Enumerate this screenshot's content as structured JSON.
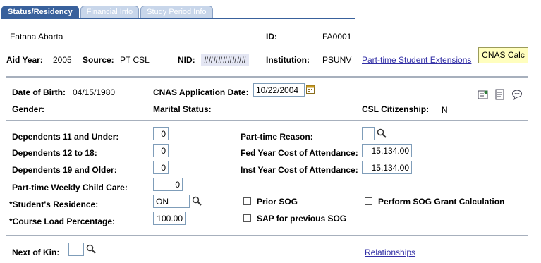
{
  "tabs": [
    "Status/Residency",
    "Financial Info",
    "Study Period Info"
  ],
  "header": {
    "name": "Fatana Abarta",
    "id_label": "ID:",
    "id_value": "FA0001",
    "aid_year_label": "Aid Year:",
    "aid_year_value": "2005",
    "source_label": "Source:",
    "source_value": "PT CSL",
    "nid_label": "NID:",
    "nid_value": "#########",
    "institution_label": "Institution:",
    "institution_value": "PSUNV",
    "extensions_link": "Part-time Student Extensions",
    "cnas_calc_button": "CNAS Calc"
  },
  "personal": {
    "dob_label": "Date of Birth:",
    "dob_value": "04/15/1980",
    "cnas_app_date_label": "CNAS Application Date:",
    "cnas_app_date_value": "10/22/2004",
    "gender_label": "Gender:",
    "marital_label": "Marital Status:",
    "citizenship_label": "CSL Citizenship:",
    "citizenship_value": "N"
  },
  "dependents": {
    "dep11_label": "Dependents 11 and Under:",
    "dep11_value": "0",
    "dep12_label": "Dependents 12 to 18:",
    "dep12_value": "0",
    "dep19_label": "Dependents 19 and Older:",
    "dep19_value": "0",
    "childcare_label": "Part-time Weekly Child Care:",
    "childcare_value": "0",
    "residence_label": "*Student's Residence:",
    "residence_value": "ON",
    "courseload_label": "*Course Load Percentage:",
    "courseload_value": "100.00"
  },
  "costs": {
    "pt_reason_label": "Part-time Reason:",
    "pt_reason_value": "",
    "fed_coa_label": "Fed Year Cost of Attendance:",
    "fed_coa_value": "15,134.00",
    "inst_coa_label": "Inst Year Cost of Attendance:",
    "inst_coa_value": "15,134.00",
    "prior_sog_label": "Prior SOG",
    "perform_sog_label": "Perform SOG Grant Calculation",
    "sap_label": "SAP for previous SOG"
  },
  "footer": {
    "next_of_kin_label": "Next of Kin:",
    "next_of_kin_value": "",
    "relationships_link": "Relationships"
  },
  "icons": [
    "calendar-icon",
    "lookup-icon",
    "address-icon",
    "notes-icon",
    "comments-icon"
  ],
  "colors": {
    "tab_active": "#39619c",
    "tab_inactive": "#c8d6ea",
    "link": "#3330a6",
    "cnas_button": "#fffebe"
  }
}
